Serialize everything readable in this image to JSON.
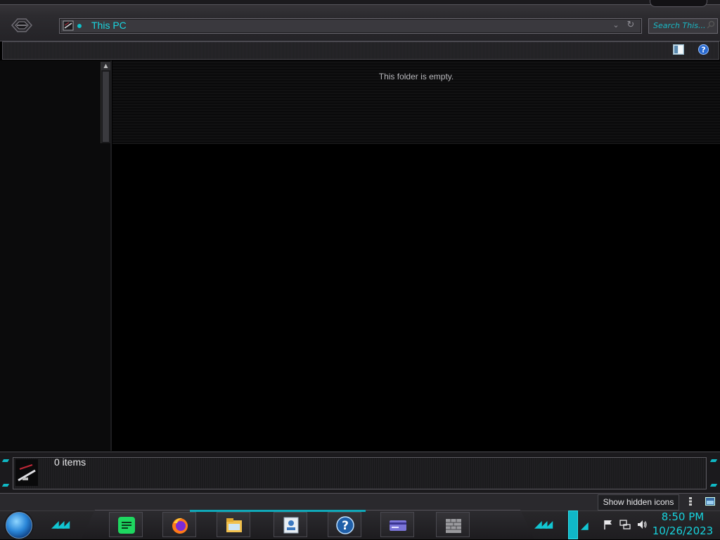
{
  "window": {
    "address": "This PC",
    "search_placeholder": "Search This...",
    "empty_message": "This folder is empty.",
    "item_count": "0 items"
  },
  "taskbar": {
    "tooltip": "Show hidden icons",
    "clock_time": "8:50 PM",
    "clock_date": "10/26/2023",
    "pinned": [
      {
        "name": "spotify-icon"
      },
      {
        "name": "firefox-icon"
      },
      {
        "name": "file-explorer-icon"
      },
      {
        "name": "user-account-icon"
      },
      {
        "name": "help-icon"
      },
      {
        "name": "card-icon"
      },
      {
        "name": "firewall-icon"
      }
    ]
  },
  "colors": {
    "accent": "#17d3dd",
    "background": "#000000",
    "chrome": "#2c2b2f"
  }
}
